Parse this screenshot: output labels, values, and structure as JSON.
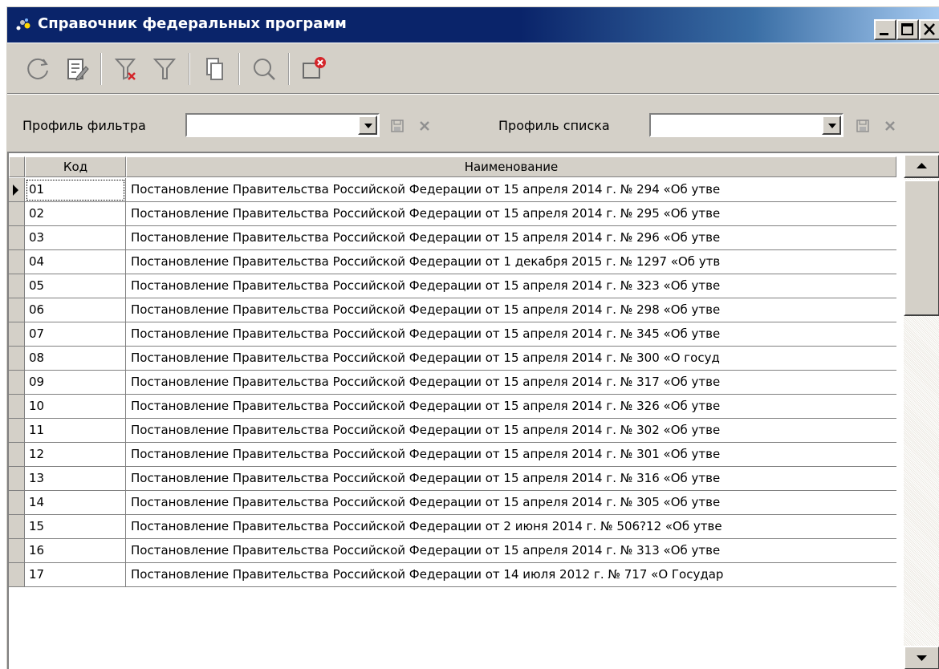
{
  "window": {
    "title": "Справочник федеральных программ",
    "controls": {
      "minimize": "_",
      "maximize": "□",
      "close": "✕"
    }
  },
  "toolbar": {
    "buttons": [
      {
        "name": "refresh",
        "icon": "refresh-icon"
      },
      {
        "name": "edit",
        "icon": "edit-document-icon"
      },
      {
        "name": "clear-filter",
        "icon": "filter-clear-icon"
      },
      {
        "name": "filter",
        "icon": "filter-icon"
      },
      {
        "name": "copy",
        "icon": "copy-icon"
      },
      {
        "name": "search",
        "icon": "search-icon"
      },
      {
        "name": "close-window",
        "icon": "window-close-icon"
      }
    ]
  },
  "filters": {
    "filter_profile_label": "Профиль фильтра",
    "filter_profile_value": "",
    "list_profile_label": "Профиль списка",
    "list_profile_value": ""
  },
  "grid": {
    "columns": [
      "Код",
      "Наименование"
    ],
    "rows": [
      {
        "code": "01",
        "name": "Постановление Правительства Российской Федерации от 15 апреля 2014 г. № 294 «Об утве"
      },
      {
        "code": "02",
        "name": "Постановление Правительства Российской Федерации от 15 апреля 2014 г. № 295 «Об утве"
      },
      {
        "code": "03",
        "name": "Постановление Правительства Российской Федерации от 15 апреля 2014 г. № 296 «Об утве"
      },
      {
        "code": "04",
        "name": "Постановление Правительства Российской Федерации от 1 декабря 2015 г. № 1297 «Об утв"
      },
      {
        "code": "05",
        "name": "Постановление Правительства Российской Федерации от 15 апреля 2014 г. № 323 «Об утве"
      },
      {
        "code": "06",
        "name": "Постановление Правительства Российской Федерации от 15 апреля 2014 г. № 298 «Об утве"
      },
      {
        "code": "07",
        "name": "Постановление Правительства Российской Федерации от 15 апреля 2014 г. № 345 «Об утве"
      },
      {
        "code": "08",
        "name": "Постановление Правительства Российской Федерации от 15 апреля 2014 г. № 300 «О госуд"
      },
      {
        "code": "09",
        "name": "Постановление Правительства Российской Федерации от 15 апреля 2014 г. № 317 «Об утве"
      },
      {
        "code": "10",
        "name": "Постановление Правительства Российской Федерации от 15 апреля 2014 г. № 326 «Об утве"
      },
      {
        "code": "11",
        "name": "Постановление Правительства Российской Федерации от 15 апреля 2014 г. № 302 «Об утве"
      },
      {
        "code": "12",
        "name": "Постановление Правительства Российской Федерации от 15 апреля 2014 г. № 301 «Об утве"
      },
      {
        "code": "13",
        "name": "Постановление Правительства Российской Федерации от 15 апреля  2014 г. № 316 «Об утве"
      },
      {
        "code": "14",
        "name": "Постановление Правительства Российской Федерации от 15 апреля  2014 г. № 305 «Об утве"
      },
      {
        "code": "15",
        "name": "Постановление Правительства Российской Федерации от 2 июня 2014 г. № 506?12 «Об утве"
      },
      {
        "code": "16",
        "name": "Постановление Правительства Российской Федерации от 15 апреля 2014 г. № 313 «Об утве"
      },
      {
        "code": "17",
        "name": "Постановление Правительства Российской Федерации от 14 июля 2012 г. № 717 «О Государ"
      }
    ]
  }
}
